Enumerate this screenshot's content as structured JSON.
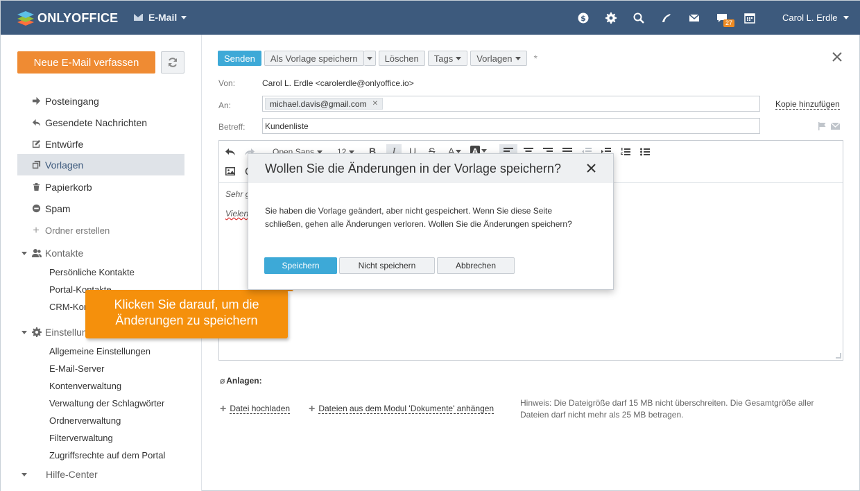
{
  "header": {
    "brand": "ONLYOFFICE",
    "module": "E-Mail",
    "user": "Carol L. Erdle",
    "chat_badge": "27",
    "icons": [
      "dollar-icon",
      "gear-icon",
      "search-icon",
      "feed-icon",
      "mail-icon",
      "chat-icon",
      "calendar-icon"
    ]
  },
  "sidebar": {
    "compose_label": "Neue E-Mail verfassen",
    "folders": [
      {
        "label": "Posteingang",
        "icon": "inbox-arrow-icon"
      },
      {
        "label": "Gesendete Nachrichten",
        "icon": "sent-reply-icon"
      },
      {
        "label": "Entwürfe",
        "icon": "draft-icon"
      },
      {
        "label": "Vorlagen",
        "icon": "template-icon"
      },
      {
        "label": "Papierkorb",
        "icon": "trash-icon"
      },
      {
        "label": "Spam",
        "icon": "spam-icon"
      }
    ],
    "create_folder": "Ordner erstellen",
    "contacts_title": "Kontakte",
    "contacts": [
      "Persönliche Kontakte",
      "Portal-Kontakte",
      "CRM-Kontakte"
    ],
    "settings_title": "Einstellungen",
    "settings": [
      "Allgemeine Einstellungen",
      "E-Mail-Server",
      "Kontenverwaltung",
      "Verwaltung der Schlagwörter",
      "Ordnerverwaltung",
      "Filterverwaltung",
      "Zugriffsrechte auf dem Portal"
    ],
    "help_title": "Hilfe-Center"
  },
  "toolbar": {
    "send": "Senden",
    "save_template": "Als Vorlage speichern",
    "delete": "Löschen",
    "tags": "Tags",
    "templates": "Vorlagen",
    "modified_marker": "*"
  },
  "form": {
    "from_label": "Von:",
    "from_value": "Carol L. Erdle <carolerdle@onlyoffice.io>",
    "to_label": "An:",
    "to_recipient": "michael.davis@gmail.com",
    "add_copy": "Kopie hinzufügen",
    "subject_label": "Betreff:",
    "subject_value": "Kundenliste"
  },
  "editor": {
    "font": "Open Sans",
    "size": "12",
    "body_line1": "Sehr g",
    "body_line2": "Vielen"
  },
  "attachments": {
    "title": "Anlagen:",
    "upload": "Datei hochladen",
    "attach_docs": "Dateien aus dem Modul 'Dokumente' anhängen",
    "hint": "Hinweis: Die Dateigröße darf 15 MB nicht überschreiten. Die Gesamtgröße aller Dateien darf nicht mehr als 25 MB betragen."
  },
  "dialog": {
    "title": "Wollen Sie die Änderungen in der Vorlage speichern?",
    "text": "Sie haben die Vorlage geändert, aber nicht gespeichert. Wenn Sie diese Seite schließen, gehen alle Änderungen verloren. Wollen Sie die Änderungen speichern?",
    "save": "Speichern",
    "dont_save": "Nicht speichern",
    "cancel": "Abbrechen"
  },
  "callout": {
    "line1": "Klicken Sie darauf, um die",
    "line2": "Änderungen zu speichern"
  },
  "colors": {
    "header_bg": "#3d5a7d",
    "compose_orange": "#ef8b33",
    "primary_blue": "#3da9d7",
    "callout_orange": "#f5900c"
  }
}
